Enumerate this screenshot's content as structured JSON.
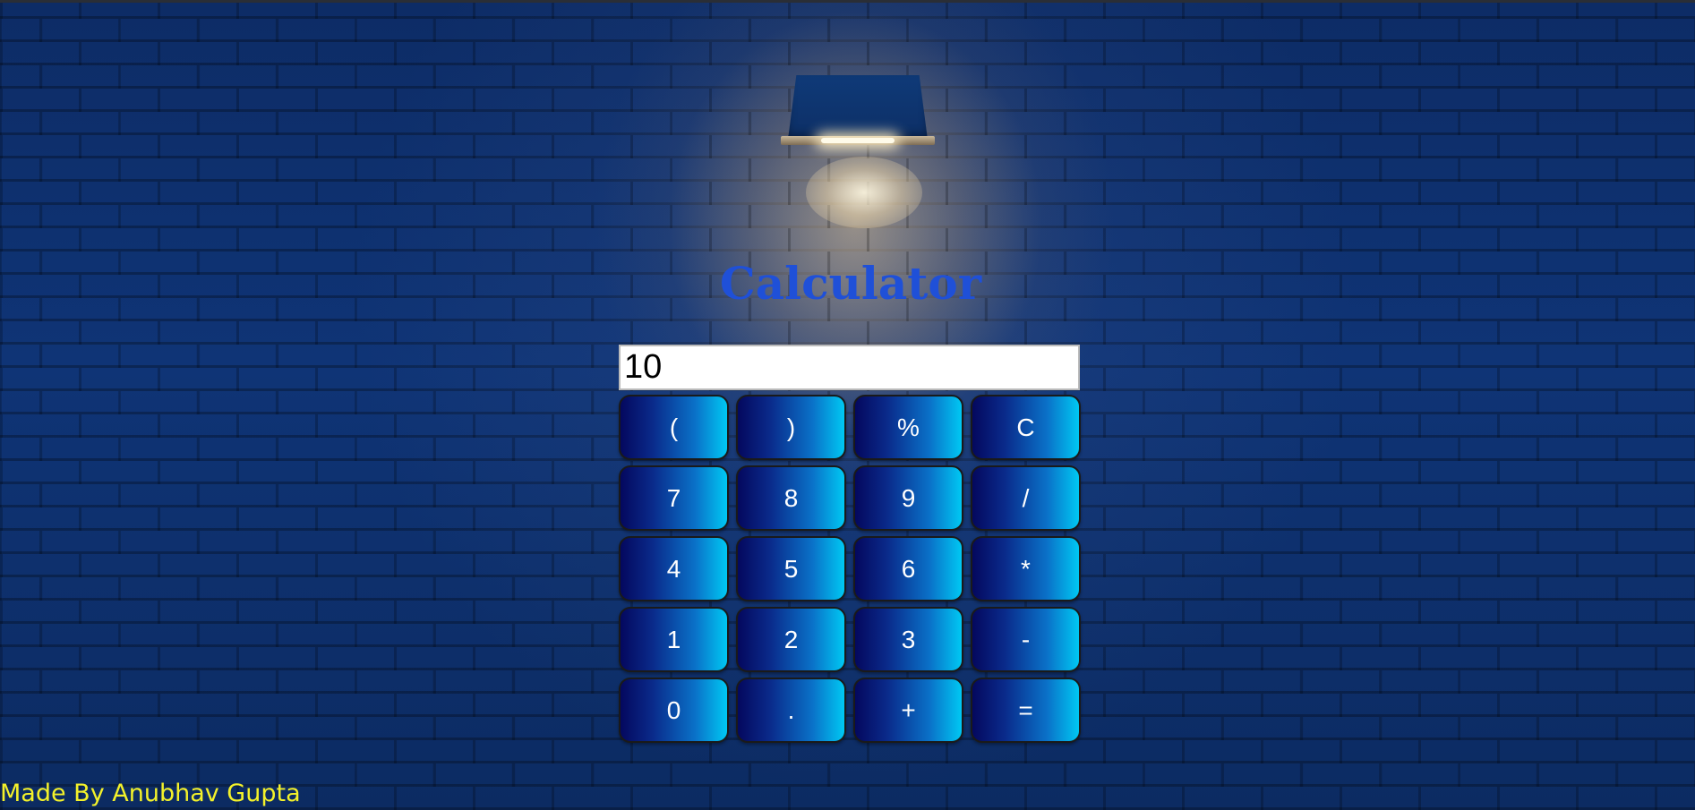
{
  "app": {
    "title": "Calculator"
  },
  "display": {
    "value": "10"
  },
  "keys": [
    {
      "label": "(",
      "name": "key-open-paren"
    },
    {
      "label": ")",
      "name": "key-close-paren"
    },
    {
      "label": "%",
      "name": "key-percent"
    },
    {
      "label": "C",
      "name": "key-clear"
    },
    {
      "label": "7",
      "name": "key-7"
    },
    {
      "label": "8",
      "name": "key-8"
    },
    {
      "label": "9",
      "name": "key-9"
    },
    {
      "label": "/",
      "name": "key-divide"
    },
    {
      "label": "4",
      "name": "key-4"
    },
    {
      "label": "5",
      "name": "key-5"
    },
    {
      "label": "6",
      "name": "key-6"
    },
    {
      "label": "*",
      "name": "key-multiply"
    },
    {
      "label": "1",
      "name": "key-1"
    },
    {
      "label": "2",
      "name": "key-2"
    },
    {
      "label": "3",
      "name": "key-3"
    },
    {
      "label": "-",
      "name": "key-subtract"
    },
    {
      "label": "0",
      "name": "key-0"
    },
    {
      "label": ".",
      "name": "key-decimal"
    },
    {
      "label": "+",
      "name": "key-add"
    },
    {
      "label": "=",
      "name": "key-equals"
    }
  ],
  "footer": {
    "credit": "Made By Anubhav Gupta"
  },
  "colors": {
    "title": "#1f50d8",
    "credit": "#f3f12a",
    "key_dark": "#04085e",
    "key_light": "#00c8f3",
    "wall": "#0c2a63"
  },
  "icons": {
    "lamp": "wall-lamp-icon"
  }
}
